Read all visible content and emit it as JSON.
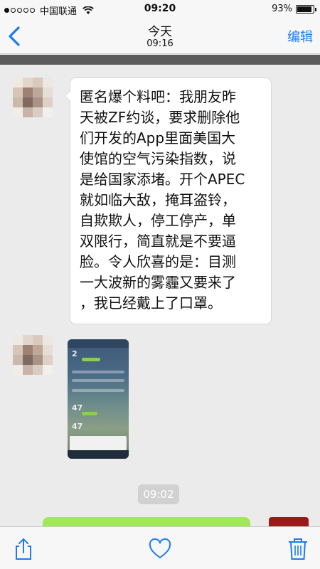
{
  "status_bar": {
    "carrier": "中国联通",
    "time": "09:20",
    "battery_percent": "93%",
    "battery_level": 0.93,
    "signal_dots_filled": 1
  },
  "nav": {
    "title": "今天",
    "subtitle": "09:16",
    "back_icon": "chevron-left-icon",
    "edit_label": "编辑",
    "accent_color": "#1a7cf0"
  },
  "messages": [
    {
      "type": "text",
      "lines": [
        "匿名爆个料吧：我朋友昨",
        "天被ZF约谈，要求删除他",
        "们开发的App里面美国大",
        "使馆的空气污染指数，说",
        "是给国家添堵。开个APEC",
        "就如临大敌，掩耳盗铃，",
        "自欺欺人，停工停产，单",
        "双限行，简直就是不要逼",
        "脸。令人欣喜的是：目测",
        "一大波新的雾霾又要来了",
        "，我已经戴上了口罩。"
      ]
    },
    {
      "type": "image",
      "thumbnail_numbers": [
        "2",
        "47",
        "47"
      ]
    }
  ],
  "timestamp": "09:02",
  "toolbar": {
    "share_icon": "share-icon",
    "like_icon": "heart-icon",
    "delete_icon": "trash-icon"
  }
}
